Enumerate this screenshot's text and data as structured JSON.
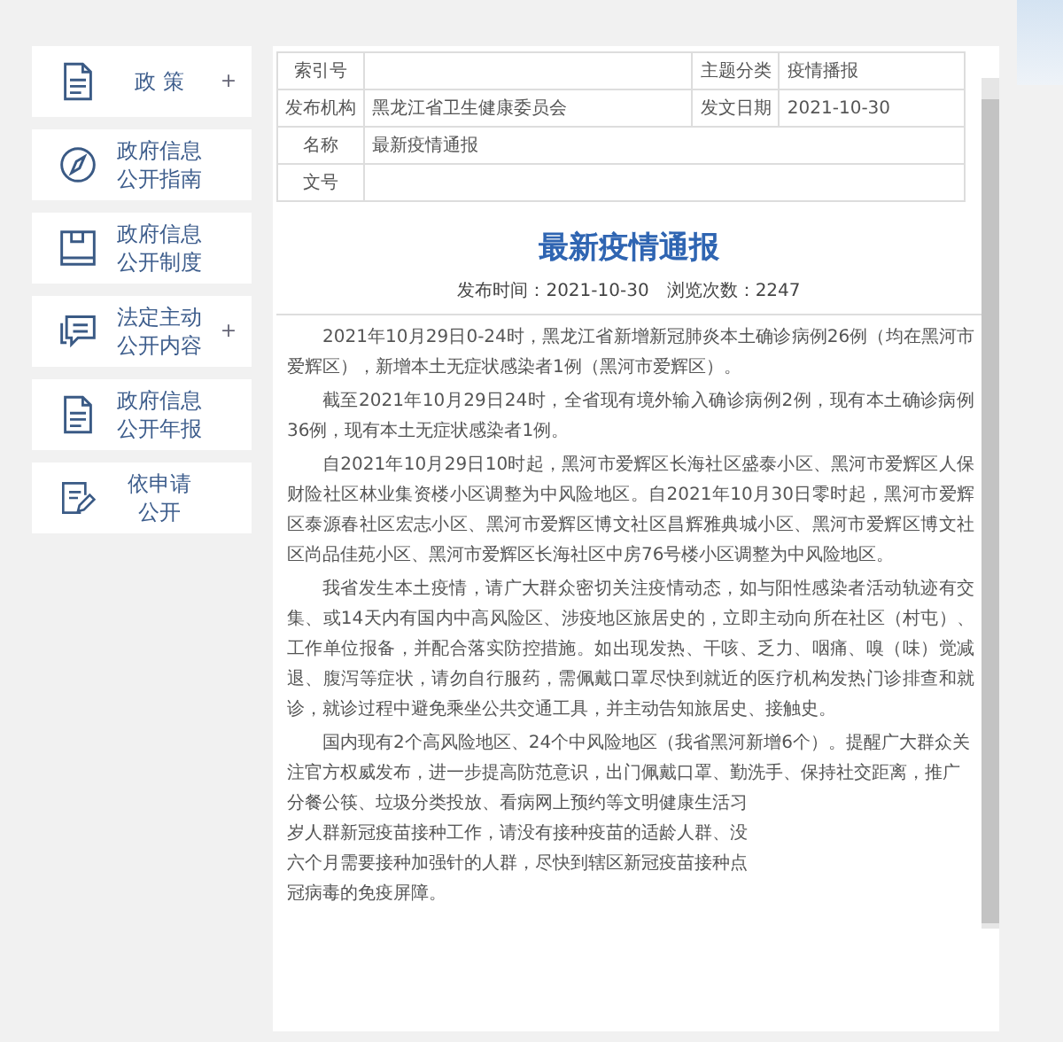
{
  "sidebar": {
    "items": [
      {
        "label_lines": [
          "政 策"
        ],
        "expandable": true
      },
      {
        "label_lines": [
          "政府信息",
          "公开指南"
        ],
        "expandable": false
      },
      {
        "label_lines": [
          "政府信息",
          "公开制度"
        ],
        "expandable": false
      },
      {
        "label_lines": [
          "法定主动",
          "公开内容"
        ],
        "expandable": true
      },
      {
        "label_lines": [
          "政府信息",
          "公开年报"
        ],
        "expandable": false
      },
      {
        "label_lines": [
          "依申请",
          "公开"
        ],
        "expandable": false
      }
    ]
  },
  "expand_mark": "+",
  "info_table": {
    "rows": [
      [
        {
          "label": "索引号"
        },
        {
          "label": "主题分类",
          "value": "疫情播报"
        }
      ],
      [
        {
          "label": "发布机构",
          "value": "黑龙江省卫生健康委员会"
        },
        {
          "label": "发文日期",
          "value": "2021-10-30"
        }
      ],
      [
        {
          "label": "名称",
          "value": "最新疫情通报"
        }
      ],
      [
        {
          "label": "文号"
        }
      ]
    ]
  },
  "article": {
    "title": "最新疫情通报",
    "meta": "发布时间：2021-10-30　浏览次数：2247",
    "paragraphs": [
      {
        "text": "2021年10月29日0-24时，黑龙江省新增新冠肺炎本土确诊病例26例（均在黑河市爱辉区），新增本土无症状感染者1例（黑河市爱辉区）。"
      },
      {
        "text": "截至2021年10月29日24时，全省现有境外输入确诊病例2例，现有本土确诊病例36例，现有本土无症状感染者1例。"
      },
      {
        "text": "自2021年10月29日10时起，黑河市爱辉区长海社区盛泰小区、黑河市爱辉区人保财险社区林业集资楼小区调整为中风险地区。自2021年10月30日零时起，黑河市爱辉区泰源春社区宏志小区、黑河市爱辉区博文社区昌辉雅典城小区、黑河市爱辉区博文社区尚品佳苑小区、黑河市爱辉区长海社区中房76号楼小区调整为中风险地区。"
      },
      {
        "text": "我省发生本土疫情，请广大群众密切关注疫情动态，如与阳性感染者活动轨迹有交集、或14天内有国内中高风险区、涉疫地区旅居史的，立即主动向所在社区（村屯）、工作单位报备，并配合落实防控措施。如出现发热、干咳、乏力、咽痛、嗅（味）觉减退、腹泻等症状，请勿自行服药，需佩戴口罩尽快到就近的医疗机构发热门诊排查和就诊，就诊过程中避免乘坐公共交通工具，并主动告知旅居史、接触史。"
      },
      {
        "lines": [
          "国内现有2个高风险地区、24个中风险地区（我省黑河新增6个）。提醒广大群众关",
          "注官方权威发布，进一步提高防范意识，出门佩戴口罩、勤洗手、保持社交距离，推广",
          "分餐公筷、垃圾分类投放、看病网上预约等文明健康生活习",
          "岁人群新冠疫苗接种工作，请没有接种疫苗的适龄人群、没",
          "六个月需要接种加强针的人群，尽快到辖区新冠疫苗接种点",
          "冠病毒的免疫屏障。"
        ]
      }
    ]
  }
}
